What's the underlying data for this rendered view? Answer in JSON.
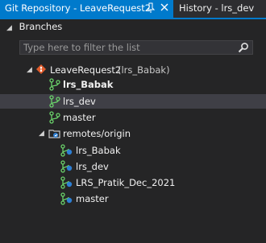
{
  "tabs": [
    {
      "label": "Git Repository - LeaveRequest2",
      "active": true,
      "pin_icon": "pin-icon",
      "close_icon": "close-icon"
    },
    {
      "label": "History - lrs_dev",
      "active": false
    }
  ],
  "branches_section": {
    "label": "Branches",
    "expanded": true
  },
  "filter": {
    "placeholder": "Type here to filter the list",
    "value": "",
    "icon": "search-icon"
  },
  "repo": {
    "name": "LeaveRequest2",
    "current_branch": "(lrs_Babak)",
    "icon": "git-repo-icon"
  },
  "local_branches": [
    {
      "name": "lrs_Babak",
      "bold": true,
      "selected": false
    },
    {
      "name": "lrs_dev",
      "bold": false,
      "selected": true
    },
    {
      "name": "master",
      "bold": false,
      "selected": false
    }
  ],
  "remotes": {
    "label": "remotes/origin",
    "icon": "remote-folder-icon",
    "branches": [
      "lrs_Babak",
      "lrs_dev",
      "LRS_Pratik_Dec_2021",
      "master"
    ]
  },
  "colors": {
    "accent": "#007acc",
    "background": "#252526",
    "selection": "#3f3f46",
    "branch_icon": "#6ad16a",
    "repo_icon": "#e05c2c"
  }
}
